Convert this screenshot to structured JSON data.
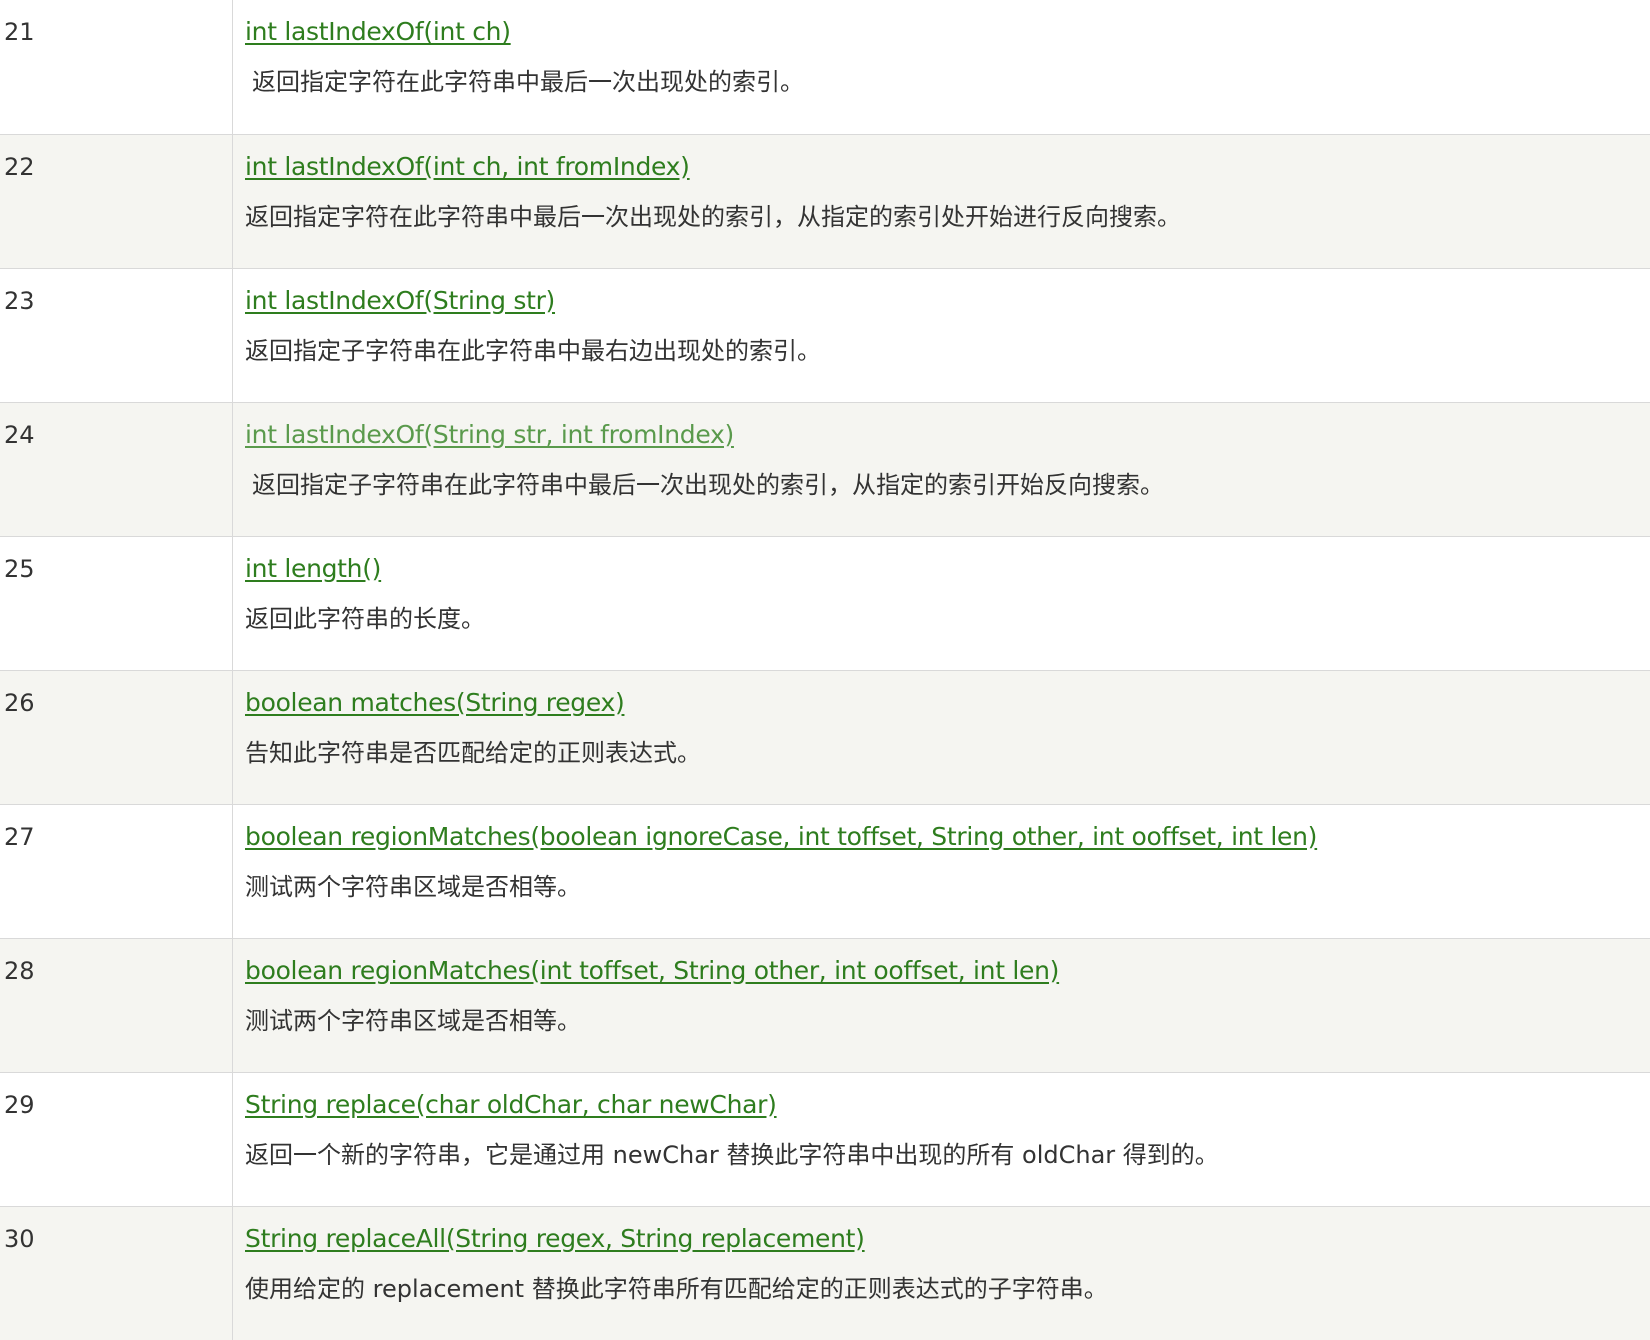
{
  "rows": [
    {
      "num": "21",
      "signature": "int lastIndexOf(int ch)",
      "description": "返回指定字符在此字符串中最后一次出现处的索引。"
    },
    {
      "num": "22",
      "signature": "int lastIndexOf(int ch, int fromIndex)",
      "description": "返回指定字符在此字符串中最后一次出现处的索引，从指定的索引处开始进行反向搜索。"
    },
    {
      "num": "23",
      "signature": "int lastIndexOf(String str)",
      "description": "返回指定子字符串在此字符串中最右边出现处的索引。"
    },
    {
      "num": "24",
      "signature": "int lastIndexOf(String str, int fromIndex)",
      "description": "返回指定子字符串在此字符串中最后一次出现处的索引，从指定的索引开始反向搜索。"
    },
    {
      "num": "25",
      "signature": "int length()",
      "description": "返回此字符串的长度。"
    },
    {
      "num": "26",
      "signature": "boolean matches(String regex)",
      "description": "告知此字符串是否匹配给定的正则表达式。"
    },
    {
      "num": "27",
      "signature": "boolean regionMatches(boolean ignoreCase, int toffset, String other, int ooffset, int len)",
      "description": "测试两个字符串区域是否相等。"
    },
    {
      "num": "28",
      "signature": "boolean regionMatches(int toffset, String other, int ooffset, int len)",
      "description": "测试两个字符串区域是否相等。"
    },
    {
      "num": "29",
      "signature": "String replace(char oldChar, char newChar)",
      "description": "返回一个新的字符串，它是通过用 newChar 替换此字符串中出现的所有 oldChar 得到的。"
    },
    {
      "num": "30",
      "signature": "String replaceAll(String regex, String replacement)",
      "description": "使用给定的 replacement 替换此字符串所有匹配给定的正则表达式的子字符串。"
    }
  ],
  "colors": {
    "link": "#2e7d1e",
    "link_visited": "#5a9a4c",
    "row_alt_bg": "#f5f5f1",
    "border": "#d9d9d9",
    "text": "#333333"
  }
}
